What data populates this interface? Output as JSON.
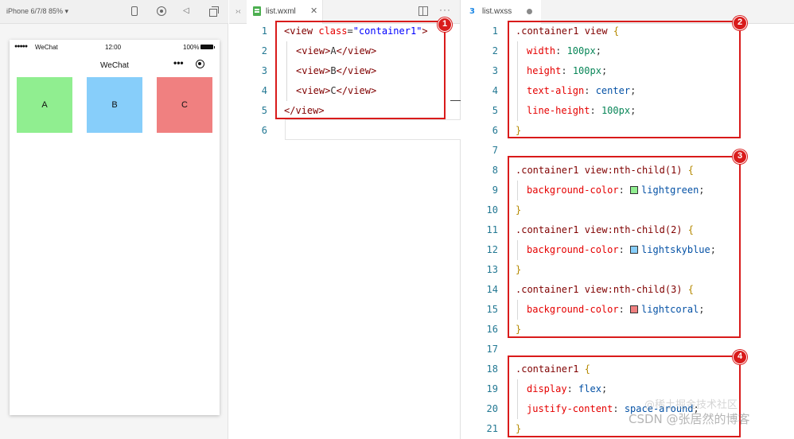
{
  "simulator": {
    "device_label": "iPhone 6/7/8 85% ▾",
    "status": {
      "signal": "●●●●●",
      "carrier": "WeChat",
      "time": "12:00",
      "battery": "100%"
    },
    "nav_title": "WeChat",
    "capsule_dots": "•••",
    "boxes": [
      {
        "label": "A",
        "color": "#90ee90"
      },
      {
        "label": "B",
        "color": "#87cefa"
      },
      {
        "label": "C",
        "color": "#f08080"
      }
    ]
  },
  "xml_editor": {
    "back_icon": "›‹",
    "tab_label": "list.wxml",
    "tab_close": "✕",
    "more_icon": "···",
    "line_numbers": [
      "1",
      "2",
      "3",
      "4",
      "5",
      "6"
    ],
    "lines": [
      {
        "a": "<view ",
        "b": "class",
        "c": "=",
        "d": "\"container1\"",
        "e": ">"
      },
      {
        "a": "<view>",
        "b": "A",
        "c": "</view>"
      },
      {
        "a": "<view>",
        "b": "B",
        "c": "</view>"
      },
      {
        "a": "<view>",
        "b": "C",
        "c": "</view>"
      },
      {
        "a": "</view>"
      }
    ]
  },
  "css_editor": {
    "tab_label": "list.wxss",
    "file_icon": "3",
    "line_numbers": [
      "1",
      "2",
      "3",
      "4",
      "5",
      "6",
      "7",
      "8",
      "9",
      "10",
      "11",
      "12",
      "13",
      "14",
      "15",
      "16",
      "17",
      "18",
      "19",
      "20",
      "21"
    ],
    "rules": {
      "r1_selector": ".container1 view ",
      "width_prop": "width",
      "width_val": "100px",
      "height_prop": "height",
      "height_val": "100px",
      "ta_prop": "text-align",
      "ta_val": "center",
      "lh_prop": "line-height",
      "lh_val": "100px",
      "r2_selector": ".container1 view:nth-child(1) ",
      "bg1_prop": "background-color",
      "bg1_val": "lightgreen",
      "r3_selector": ".container1 view:nth-child(2) ",
      "bg2_prop": "background-color",
      "bg2_val": "lightskyblue",
      "r4_selector": ".container1 view:nth-child(3) ",
      "bg3_prop": "background-color",
      "bg3_val": "lightcoral",
      "r5_selector": ".container1 ",
      "display_prop": "display",
      "display_val": "flex",
      "jc_prop": "justify-content",
      "jc_val": "space-around",
      "open_brace": "{",
      "close_brace": "}",
      "colon": ": ",
      "semi": ";"
    },
    "swatch_colors": [
      "#90ee90",
      "#87cefa",
      "#f08080"
    ]
  },
  "annotations": [
    "1",
    "2",
    "3",
    "4"
  ],
  "watermark": "CSDN @张居然的博客",
  "watermark_overlay": "@稀土掘金技术社区",
  "colors": {
    "annotation_red": "#d91b1b",
    "line_number": "#237893"
  }
}
